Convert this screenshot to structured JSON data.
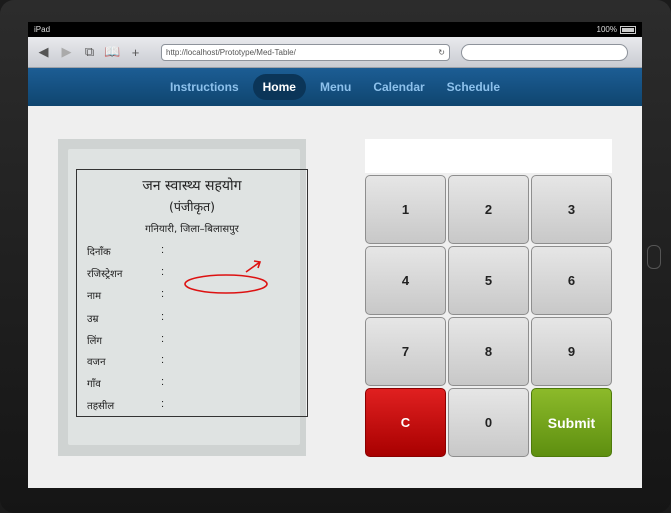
{
  "status": {
    "device": "iPad",
    "battery": "100%"
  },
  "browser": {
    "url": "http://localhost/Prototype/Med-Table/"
  },
  "nav": {
    "items": [
      {
        "label": "Instructions"
      },
      {
        "label": "Home"
      },
      {
        "label": "Menu"
      },
      {
        "label": "Calendar"
      },
      {
        "label": "Schedule"
      }
    ],
    "active": "Home"
  },
  "form": {
    "title": "जन स्वास्थ्य सहयोग",
    "subtitle": "(पंजीकृत)",
    "place": "गनियारी, जिला–बिलासपुर",
    "fields": [
      {
        "label": "दिनाँक"
      },
      {
        "label": "रजिस्ट्रेशन"
      },
      {
        "label": "नाम"
      },
      {
        "label": "उम्र"
      },
      {
        "label": "लिंग"
      },
      {
        "label": "वजन"
      },
      {
        "label": "गाँव"
      },
      {
        "label": "तहसील"
      }
    ],
    "colon": ":"
  },
  "display": {
    "value": ""
  },
  "keypad": {
    "keys": [
      "1",
      "2",
      "3",
      "4",
      "5",
      "6",
      "7",
      "8",
      "9",
      "C",
      "0",
      "Submit"
    ],
    "colors": {
      "clear": "#cc0000",
      "submit": "#77a51c"
    }
  }
}
